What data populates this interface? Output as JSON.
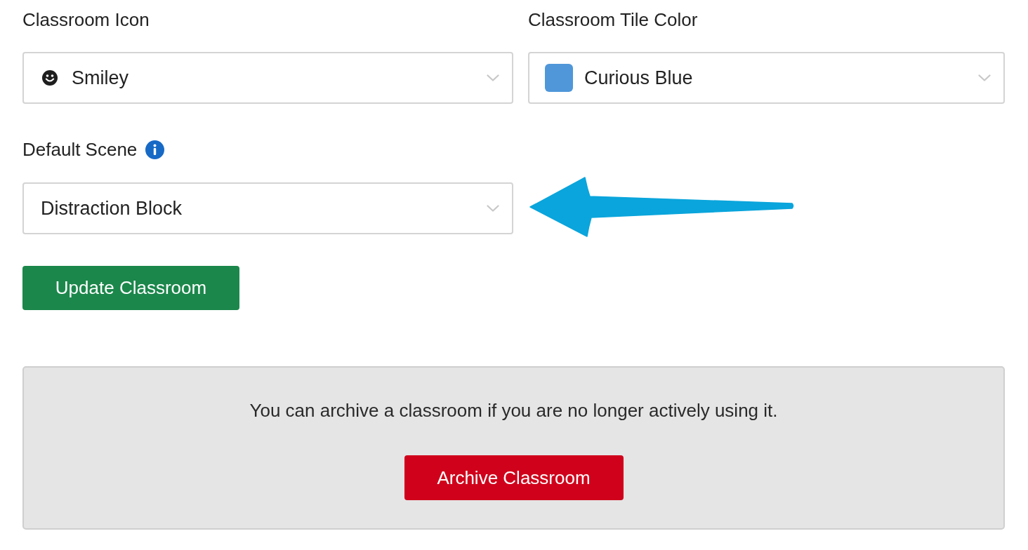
{
  "fields": [
    {
      "label": "Classroom Icon",
      "kind": "icon",
      "value": "Smiley"
    },
    {
      "label": "Classroom Tile Color",
      "kind": "color",
      "value": "Curious Blue",
      "color": "#4f97d9"
    }
  ],
  "default_scene": {
    "label": "Default Scene",
    "value": "Distraction Block"
  },
  "update_button": "Update Classroom",
  "archive_panel": {
    "message": "You can archive a classroom if you are no longer actively using it.",
    "button": "Archive Classroom"
  }
}
